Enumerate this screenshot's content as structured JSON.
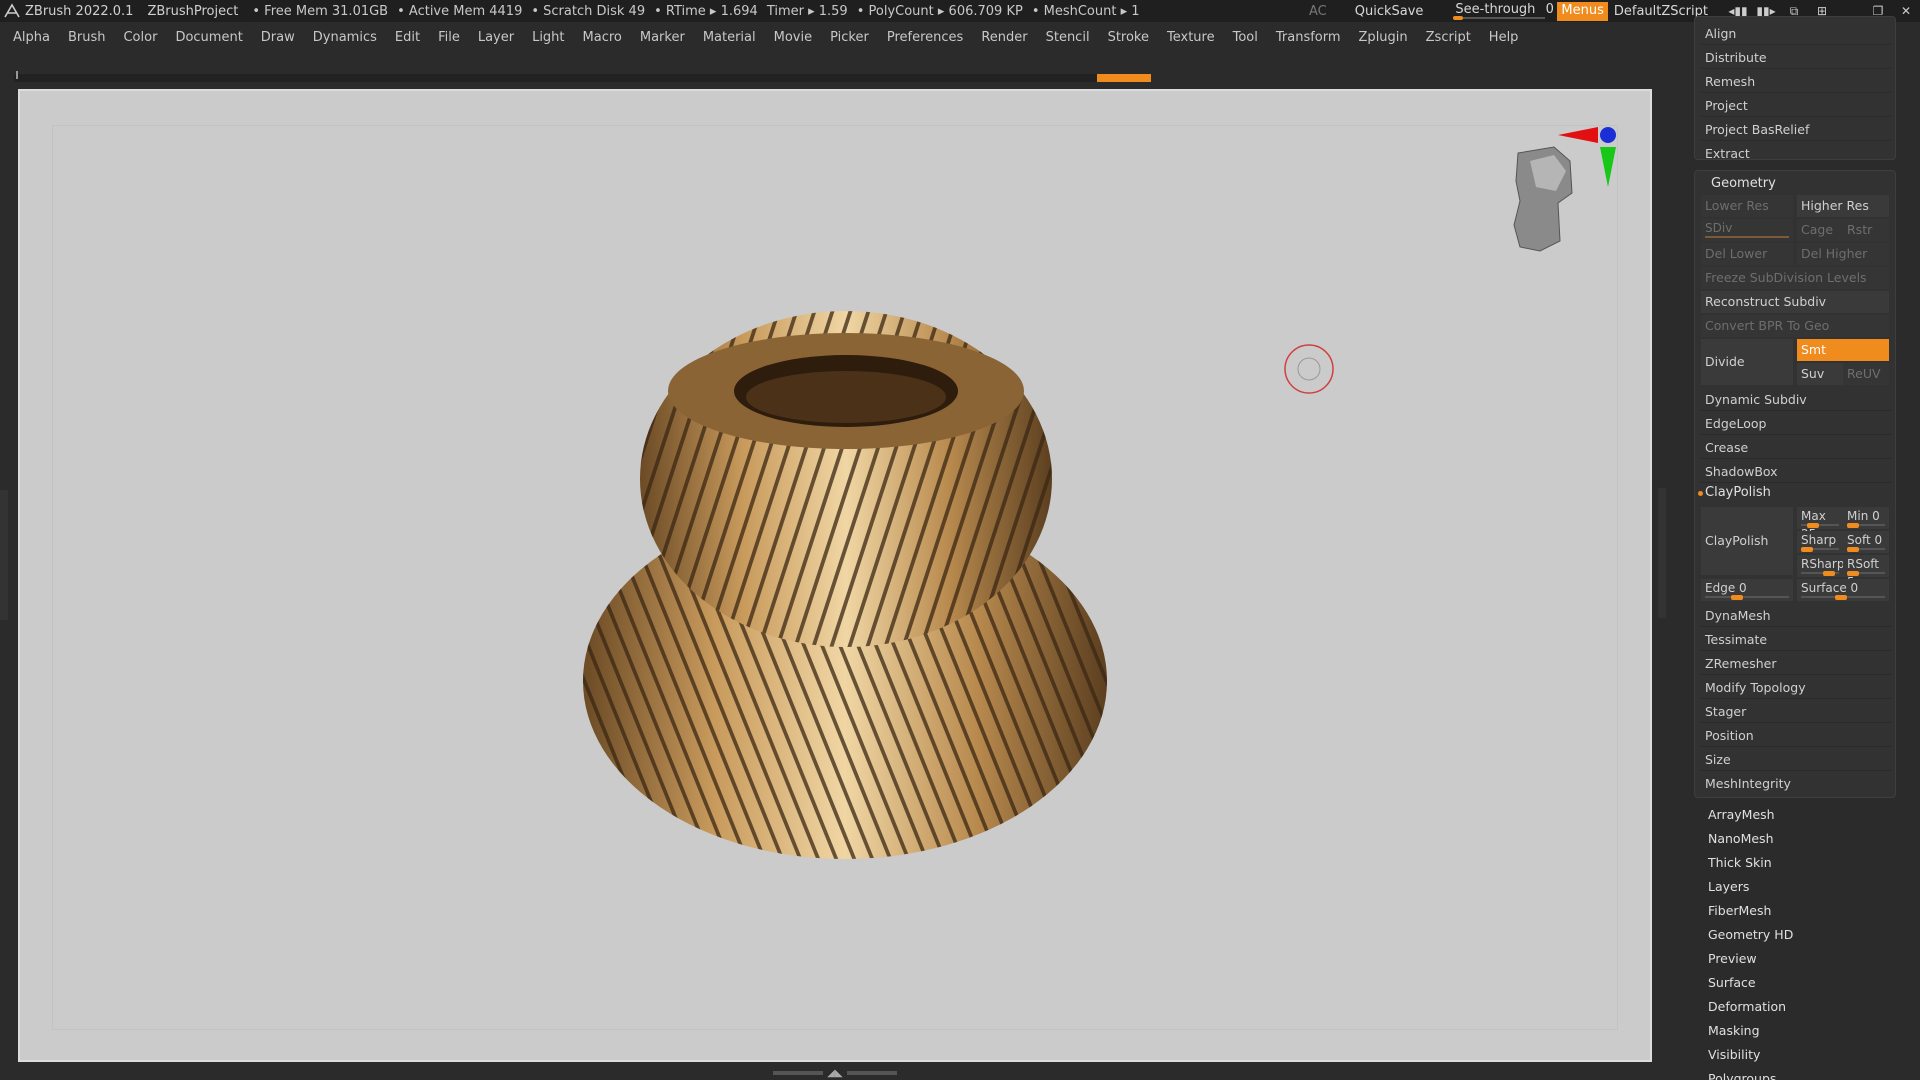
{
  "titlebar": {
    "app": "ZBrush 2022.0.1",
    "project": "ZBrushProject",
    "free_mem": "• Free Mem 31.01GB",
    "active_mem": "• Active Mem 4419",
    "scratch": "• Scratch Disk 49",
    "rtime": "• RTime ▸ 1.694",
    "timer": "Timer ▸ 1.59",
    "polycount": "• PolyCount ▸ 606.709 KP",
    "meshcount": "• MeshCount ▸ 1",
    "ac": "AC",
    "quicksave": "QuickSave",
    "see_through_label": "See-through",
    "see_through_value": "0",
    "menus": "Menus",
    "default_zscript": "DefaultZScript"
  },
  "menubar": [
    "Alpha",
    "Brush",
    "Color",
    "Document",
    "Draw",
    "Dynamics",
    "Edit",
    "File",
    "Layer",
    "Light",
    "Macro",
    "Marker",
    "Material",
    "Movie",
    "Picker",
    "Preferences",
    "Render",
    "Stencil",
    "Stroke",
    "Texture",
    "Tool",
    "Transform",
    "Zplugin",
    "Zscript",
    "Help"
  ],
  "subtool_panel": {
    "items": [
      "Align",
      "Distribute",
      "Remesh",
      "Project",
      "Project BasRelief",
      "Extract"
    ]
  },
  "geometry": {
    "header": "Geometry",
    "lower_res": "Lower Res",
    "higher_res": "Higher Res",
    "sdiv": "SDiv",
    "cage": "Cage",
    "rstr": "Rstr",
    "del_lower": "Del Lower",
    "del_higher": "Del Higher",
    "freeze": "Freeze SubDivision Levels",
    "reconstruct": "Reconstruct Subdiv",
    "convert_bpr": "Convert BPR To Geo",
    "divide": "Divide",
    "smt": "Smt",
    "suv": "Suv",
    "reuv": "ReUV",
    "dynamic_subdiv": "Dynamic Subdiv",
    "edgeloop": "EdgeLoop",
    "crease": "Crease",
    "shadowbox": "ShadowBox",
    "claypolish_header": "ClayPolish",
    "claypolish_btn": "ClayPolish",
    "max": "Max 25",
    "min": "Min 0",
    "sharp": "Sharp",
    "soft": "Soft 0",
    "rsharp": "RSharp",
    "rsoft": "RSoft 5",
    "edge": "Edge 0",
    "surface": "Surface 0",
    "rest": [
      "DynaMesh",
      "Tessimate",
      "ZRemesher",
      "Modify Topology",
      "Stager",
      "Position",
      "Size",
      "MeshIntegrity"
    ]
  },
  "tool_subpalettes": [
    "ArrayMesh",
    "NanoMesh",
    "Thick Skin",
    "Layers",
    "FiberMesh",
    "Geometry HD",
    "Preview",
    "Surface",
    "Deformation",
    "Masking",
    "Visibility",
    "Polygroups"
  ],
  "colors": {
    "accent": "#f08c1e",
    "viewport_bg": "#cbcbcb",
    "bronze": "#b8894f"
  },
  "icons": [
    "zbrush-logo-icon",
    "see-through-slider",
    "window-minimize-icon",
    "window-restore-icon",
    "window-close-icon",
    "navigation-head-icon",
    "brush-cursor-icon"
  ]
}
